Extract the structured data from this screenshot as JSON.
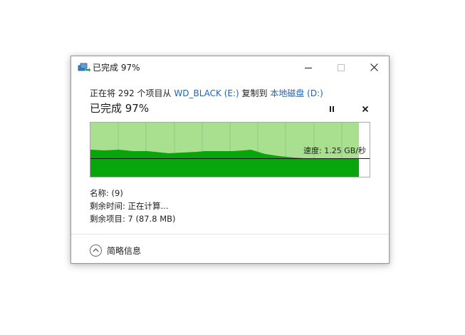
{
  "window": {
    "title": "已完成 97%",
    "minimize_icon": "minimize-icon",
    "maximize_icon": "maximize-icon",
    "close_icon": "close-icon"
  },
  "operation": {
    "prefix": "正在将 292 个项目从 ",
    "source": "WD_BLACK (E:)",
    "middle": " 复制到 ",
    "destination": "本地磁盘 (D:)"
  },
  "progress": {
    "title": "已完成 97%",
    "percent": 97,
    "pause_icon": "pause-icon",
    "cancel_icon": "cancel-icon"
  },
  "graph": {
    "speed_label": "速度: 1.25 GB/秒",
    "colors": {
      "done_area": "#a8e08f",
      "speed_area": "#07a60c",
      "gridline": "#8fc983",
      "speed_line": "#1a1a1a"
    }
  },
  "details": {
    "name": "名称: (9)",
    "time_remaining": "剩余时间: 正在计算...",
    "items_remaining": "剩余项目: 7 (87.8 MB)"
  },
  "footer": {
    "more_info_label": "简略信息",
    "more_info_icon": "chevron-up-icon"
  }
}
